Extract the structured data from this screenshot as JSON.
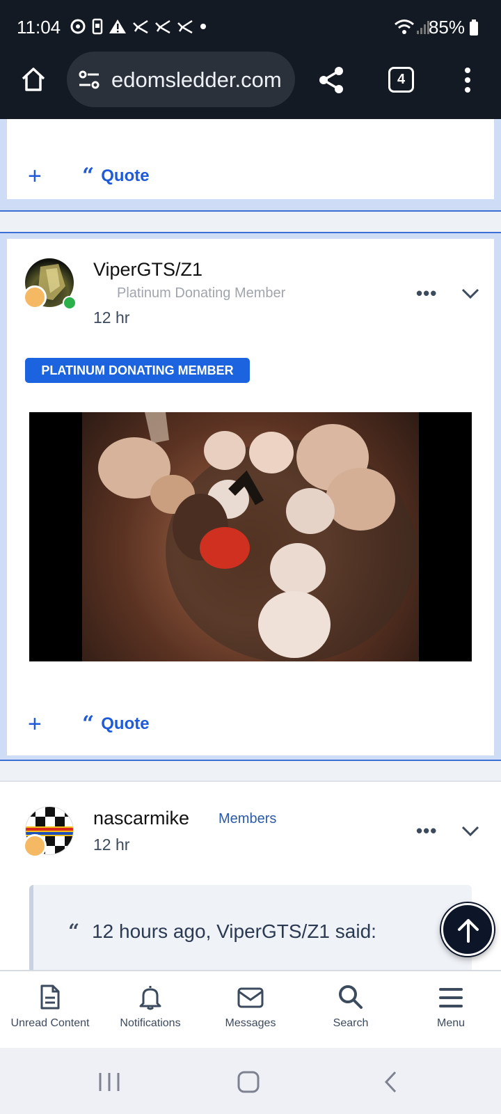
{
  "status_bar": {
    "time": "11:04",
    "battery_percent": "85%"
  },
  "browser": {
    "url": "edomsledder.com",
    "tab_count": "4"
  },
  "posts": [
    {
      "actions": {
        "quote_label": "Quote"
      }
    },
    {
      "username": "ViperGTS/Z1",
      "rank": "Platinum Donating Member",
      "time": "12 hr",
      "badge": "PLATINUM DONATING MEMBER",
      "online": true,
      "actions": {
        "quote_label": "Quote"
      }
    },
    {
      "username": "nascarmike",
      "group": "Members",
      "time": "12 hr",
      "quote_header": "12 hours ago, ViperGTS/Z1 said:"
    }
  ],
  "bottom_nav": {
    "items": [
      {
        "label": "Unread Content",
        "icon": "document-icon"
      },
      {
        "label": "Notifications",
        "icon": "bell-icon"
      },
      {
        "label": "Messages",
        "icon": "envelope-icon"
      },
      {
        "label": "Search",
        "icon": "search-icon"
      },
      {
        "label": "Menu",
        "icon": "menu-icon"
      }
    ]
  },
  "colors": {
    "accent": "#1f5bd9",
    "badge_bg": "#1c63e0",
    "online": "#2bb04b",
    "chrome_dark": "#141a24"
  }
}
